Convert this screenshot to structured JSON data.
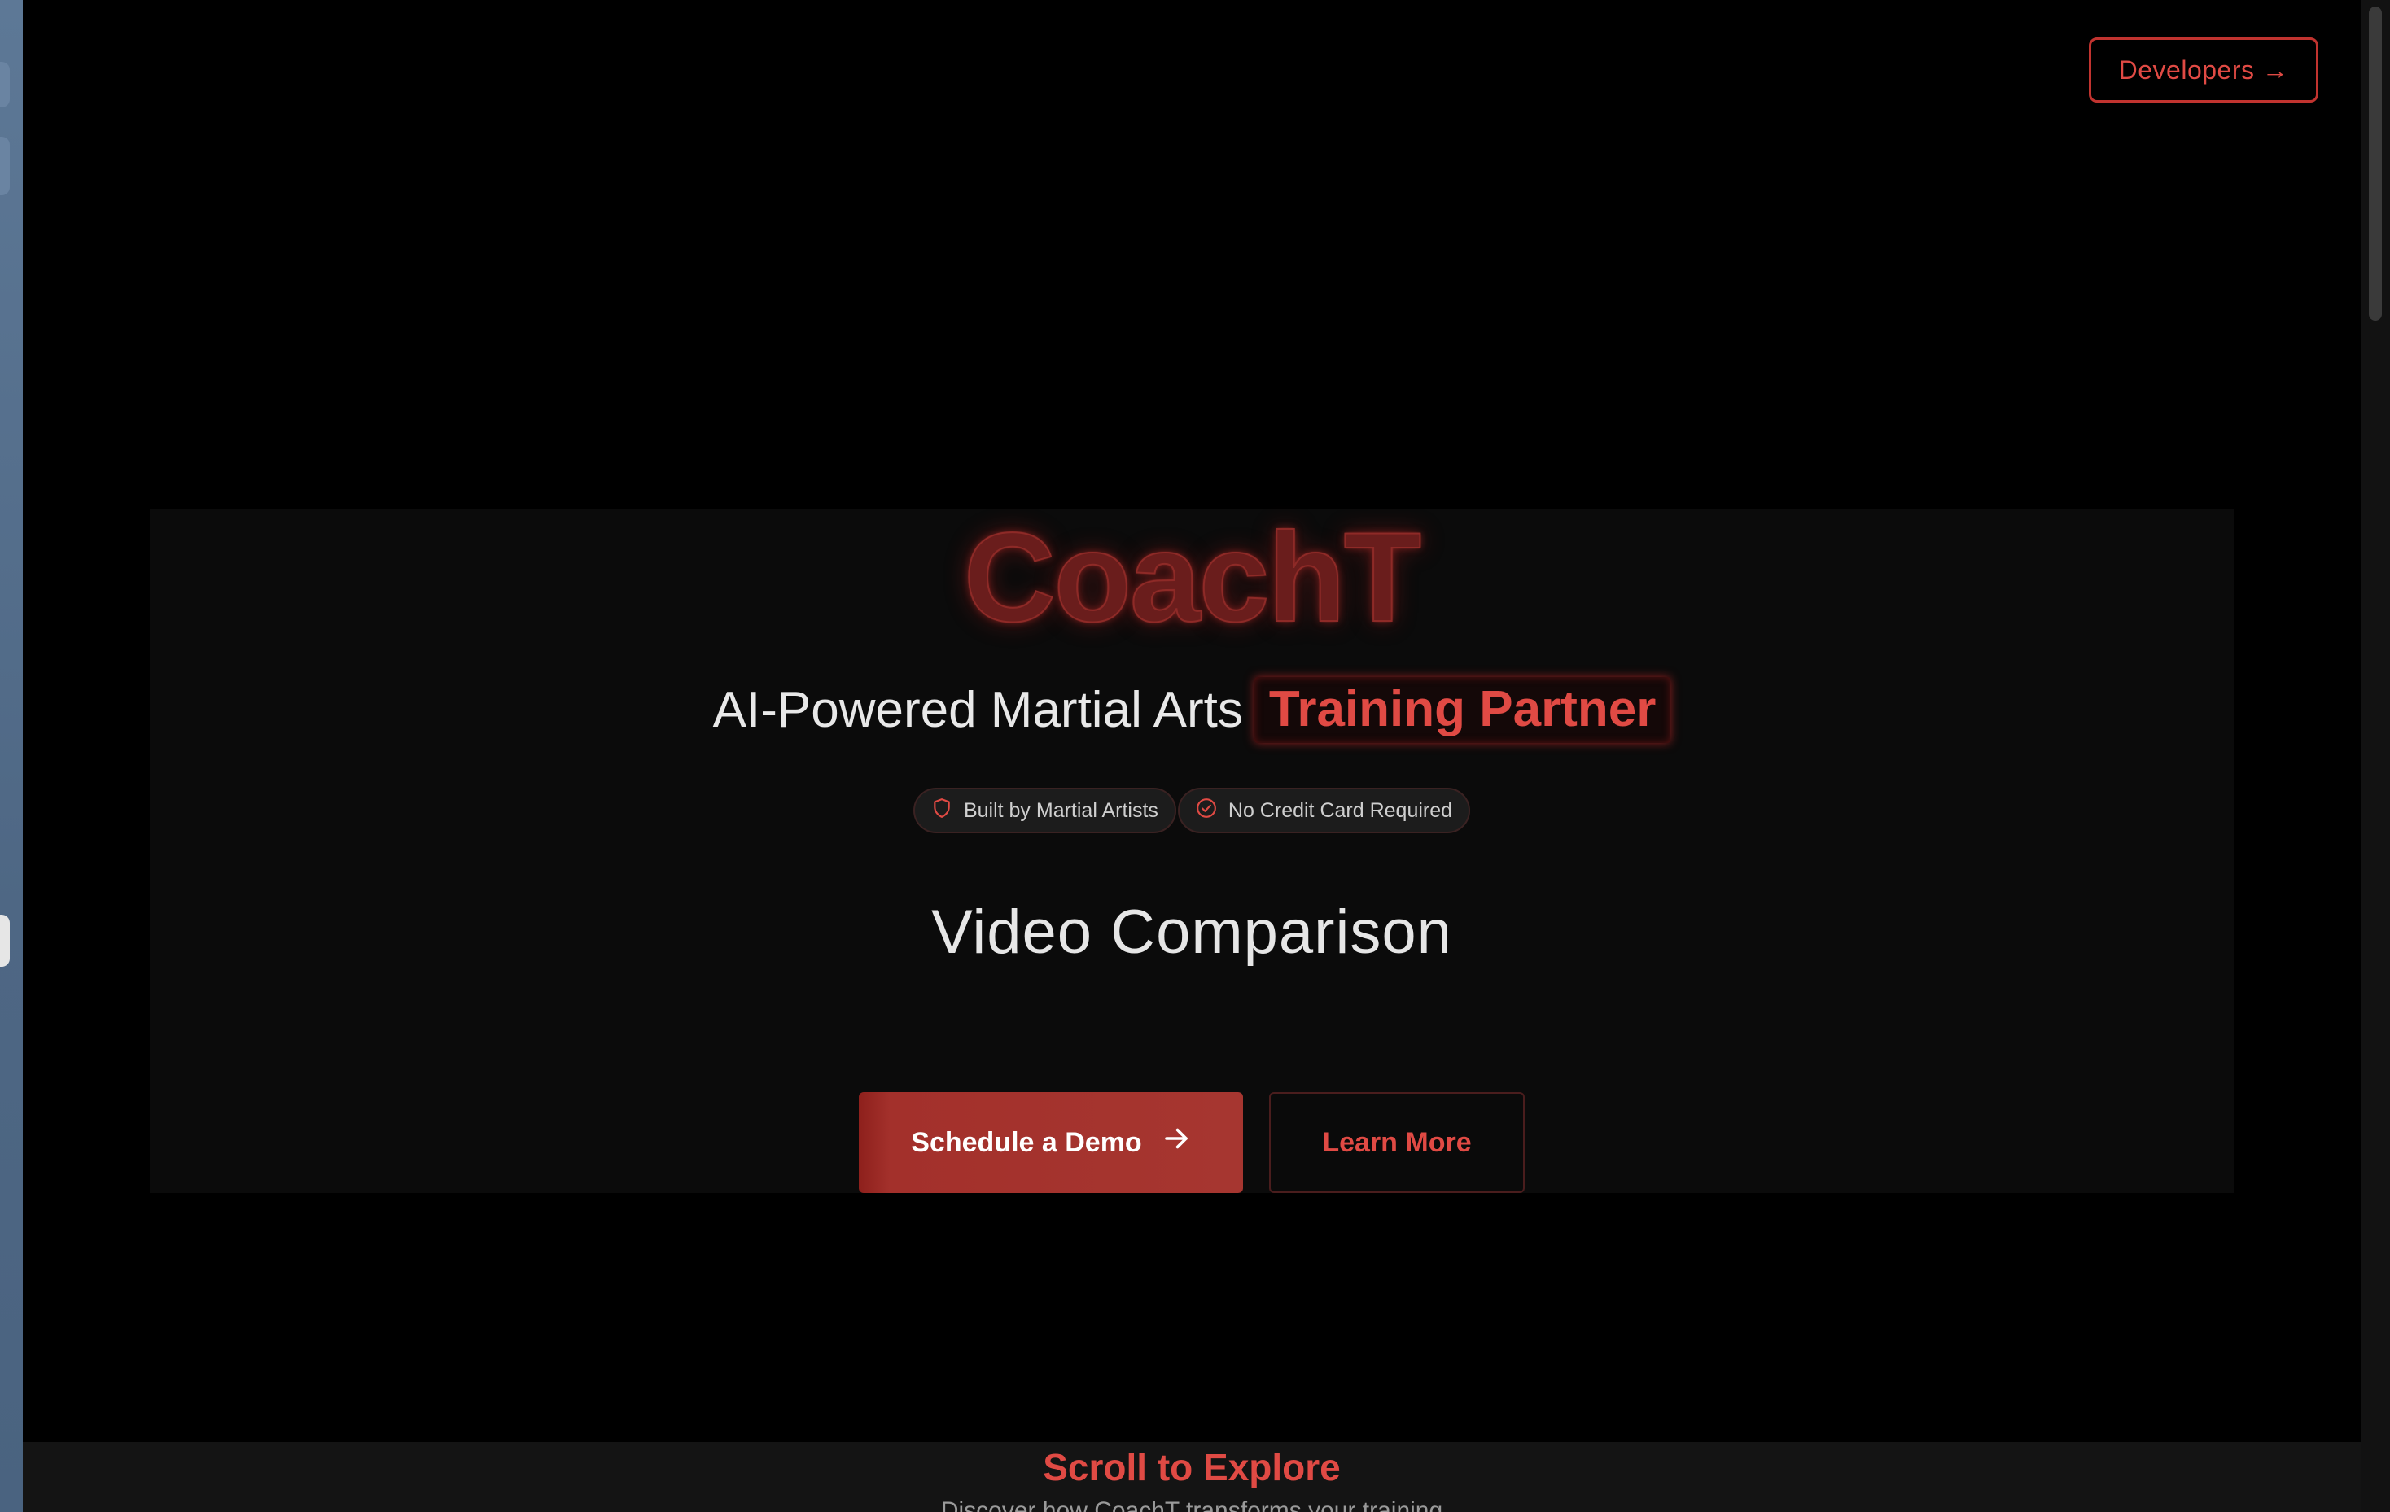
{
  "nav": {
    "developers_label": "Developers →"
  },
  "hero": {
    "logo": "CoachT",
    "tagline_main": "AI-Powered Martial Arts",
    "tagline_highlight": "Training Partner",
    "badges": [
      {
        "label": "Built by Martial Artists",
        "icon": "shield-icon"
      },
      {
        "label": "No Credit Card Required",
        "icon": "check-circle-icon"
      }
    ],
    "section_title": "Video Comparison",
    "primary_cta": "Schedule a Demo",
    "secondary_cta": "Learn More"
  },
  "scroll": {
    "title": "Scroll to Explore",
    "subtitle": "Discover how CoachT transforms your training"
  },
  "colors": {
    "accent": "#e04a44",
    "primary_button": "#a63630",
    "background": "#000000",
    "hero_panel": "#0b0b0b"
  }
}
